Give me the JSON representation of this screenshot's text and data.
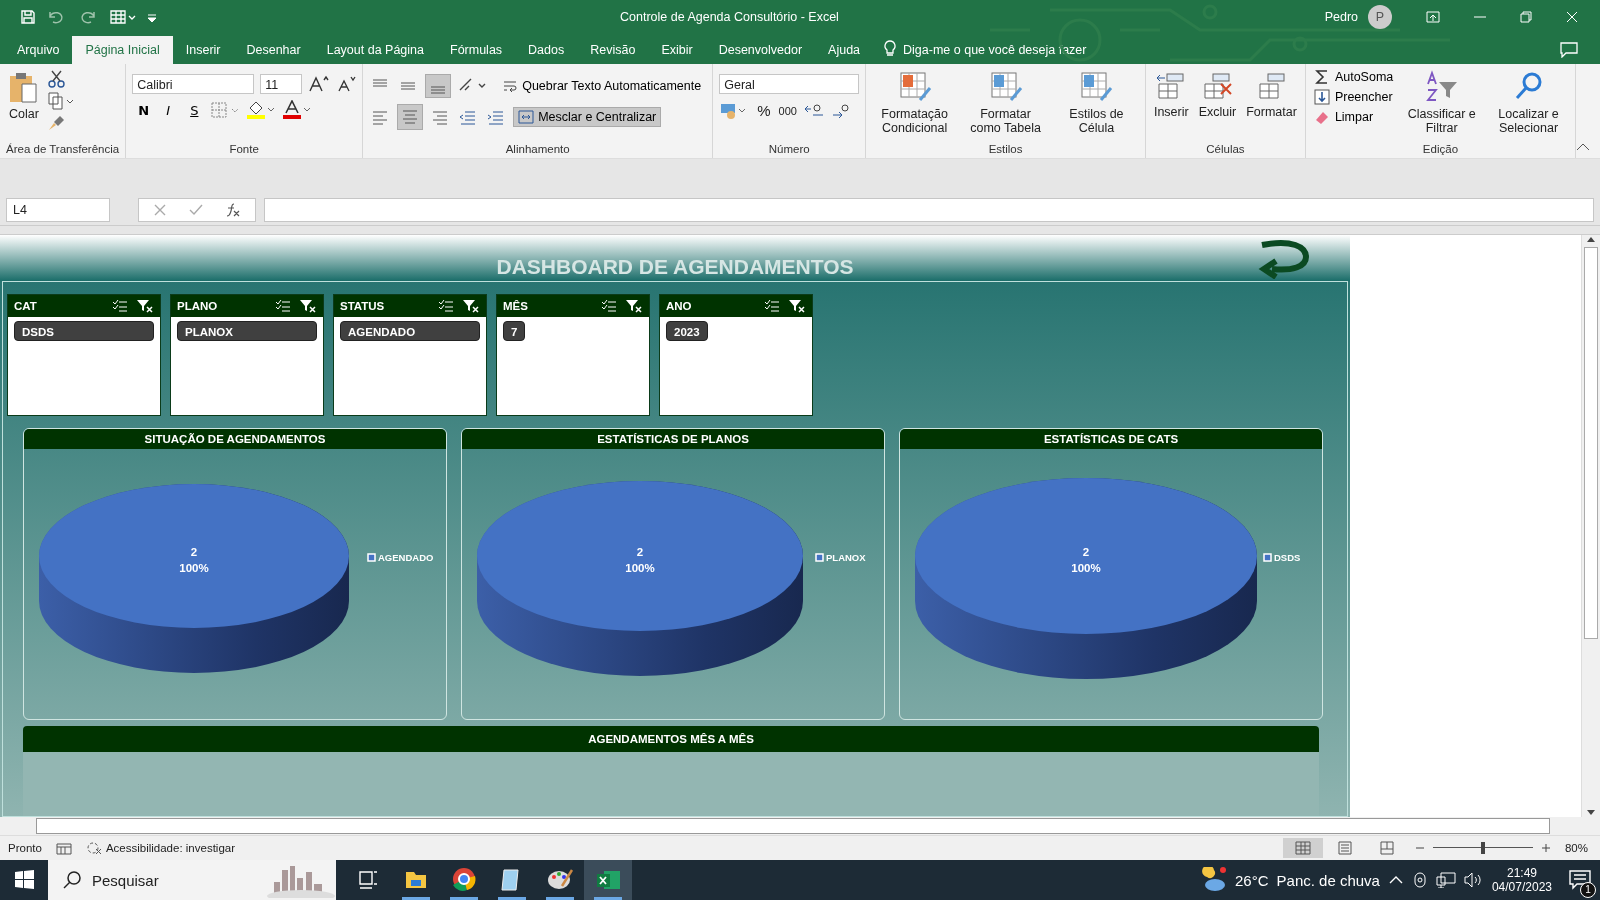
{
  "title_bar": {
    "document_title": "Controle de Agenda Consultório  -  Excel",
    "user": "Pedro",
    "avatar": "P"
  },
  "menu_tabs": [
    {
      "label": "Arquivo",
      "selected": false
    },
    {
      "label": "Página Inicial",
      "selected": true
    },
    {
      "label": "Inserir",
      "selected": false
    },
    {
      "label": "Desenhar",
      "selected": false
    },
    {
      "label": "Layout da Página",
      "selected": false
    },
    {
      "label": "Fórmulas",
      "selected": false
    },
    {
      "label": "Dados",
      "selected": false
    },
    {
      "label": "Revisão",
      "selected": false
    },
    {
      "label": "Exibir",
      "selected": false
    },
    {
      "label": "Desenvolvedor",
      "selected": false
    },
    {
      "label": "Ajuda",
      "selected": false
    }
  ],
  "tell_me": "Diga-me o que você deseja fazer",
  "ribbon": {
    "clipboard": {
      "label": "Área de Transferência",
      "paste": "Colar"
    },
    "font": {
      "label": "Fonte",
      "font_name": "Calibri",
      "font_size": "11",
      "bold": "N",
      "italic": "I",
      "underline": "S"
    },
    "alignment": {
      "label": "Alinhamento",
      "wrap": "Quebrar Texto Automaticamente",
      "merge": "Mesclar e Centralizar"
    },
    "number": {
      "label": "Número",
      "format": "Geral",
      "percent": "%",
      "thousands": "000"
    },
    "styles": {
      "label": "Estilos",
      "buttons": [
        "Formatação Condicional",
        "Formatar como Tabela",
        "Estilos de Célula"
      ]
    },
    "cells": {
      "label": "Células",
      "buttons": [
        "Inserir",
        "Excluir",
        "Formatar"
      ]
    },
    "editing": {
      "label": "Edição",
      "small": [
        "AutoSoma",
        "Preencher",
        "Limpar"
      ],
      "buttons": [
        "Classificar e Filtrar",
        "Localizar e Selecionar"
      ]
    }
  },
  "formula_bar": {
    "name_box": "L4"
  },
  "dashboard": {
    "title": "DASHBOARD DE AGENDAMENTOS",
    "slicers": [
      {
        "header": "CAT",
        "kind": "single_column",
        "items": [
          {
            "label": "DSDS",
            "selected": true
          }
        ]
      },
      {
        "header": "PLANO",
        "kind": "single_column",
        "items": [
          {
            "label": "PLANOX",
            "selected": true
          }
        ]
      },
      {
        "header": "STATUS",
        "kind": "single_column",
        "items": [
          {
            "label": "AGENDADO",
            "selected": true
          }
        ]
      },
      {
        "header": "MÊS",
        "kind": "multi_column",
        "items": [
          {
            "label": "7",
            "selected": true
          }
        ]
      },
      {
        "header": "ANO",
        "kind": "multi_column",
        "items": [
          {
            "label": "2023",
            "selected": true
          }
        ]
      }
    ],
    "charts": [
      {
        "chart_data": {
          "type": "pie",
          "title": "SITUAÇÃO DE AGENDAMENTOS",
          "categories": [
            "AGENDADO"
          ],
          "values": [
            2
          ],
          "data_labels": true,
          "annotations": [
            {
              "text": "100%"
            }
          ]
        }
      },
      {
        "chart_data": {
          "type": "pie",
          "title": "ESTATÍSTICAS DE PLANOS",
          "categories": [
            "PLANOX"
          ],
          "values": [
            2
          ],
          "data_labels": true,
          "annotations": [
            {
              "text": "100%"
            }
          ]
        }
      },
      {
        "chart_data": {
          "type": "pie",
          "title": "ESTATÍSTICAS DE CATS",
          "categories": [
            "DSDS"
          ],
          "values": [
            2
          ],
          "data_labels": true,
          "annotations": [
            {
              "text": "100%"
            }
          ]
        }
      }
    ],
    "monthly_panel": {
      "title": "AGENDAMENTOS MÊS A MÊS"
    }
  },
  "status_bar": {
    "status": "Pronto",
    "accessibility": "Acessibilidade: investigar",
    "zoom": "80%",
    "zoom_slider": {
      "level": 0.5
    }
  },
  "taskbar": {
    "search": {
      "placeholder": "Pesquisar"
    },
    "temperature": "26°C",
    "weather": "Panc. de chuva",
    "time": "21:49",
    "date": "04/07/2023",
    "notifications": "1"
  }
}
